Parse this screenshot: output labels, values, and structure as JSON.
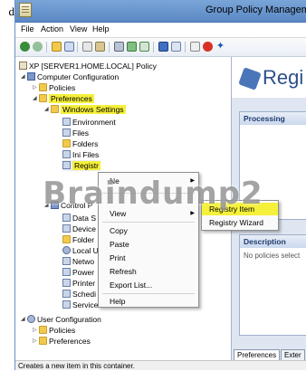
{
  "stray_char": "d",
  "window": {
    "title": "Group Policy Managemer"
  },
  "menubar": {
    "items": [
      "File",
      "Action",
      "View",
      "Help"
    ]
  },
  "toolbar": {
    "icons": [
      "back-icon",
      "forward-icon",
      "up-icon",
      "show-hide-tree-icon",
      "copy-icon",
      "paste-icon",
      "print-icon",
      "refresh-icon",
      "export-icon",
      "help-icon",
      "view-icon",
      "properties-icon",
      "delete-icon",
      "new-icon"
    ],
    "colors": {
      "back": "#3a8c3a",
      "delete": "#d93025",
      "new": "#1a56b8"
    }
  },
  "tree": {
    "root": "XP [SERVER1.HOME.LOCAL] Policy",
    "computer_config": "Computer Configuration",
    "policies": "Policies",
    "preferences": "Preferences",
    "windows_settings": "Windows Settings",
    "ws_children": [
      "Environment",
      "Files",
      "Folders",
      "Ini Files"
    ],
    "registry": "Registr",
    "control_panel": "Control P",
    "cp_children": [
      "Data S",
      "Device",
      "Folder",
      "Local U",
      "Netwo",
      "Power",
      "Printer",
      "Schedi",
      "Services"
    ],
    "user_config": "User Configuration",
    "user_policies": "Policies",
    "user_preferences": "Preferences"
  },
  "context_menu": {
    "items": [
      "Ne",
      "View",
      "Copy",
      "Paste",
      "Print",
      "Refresh",
      "Export List...",
      "Help"
    ]
  },
  "submenu": {
    "items": [
      "Registry Item",
      "Registry Wizard"
    ]
  },
  "right_pane": {
    "title": "Regi",
    "processing_label": "Processing",
    "description_label": "Description",
    "description_text": "No policies select"
  },
  "tabs": [
    "Preferences",
    "Exter"
  ],
  "status": "Creates a new item in this container.",
  "watermark": "Braindump2"
}
